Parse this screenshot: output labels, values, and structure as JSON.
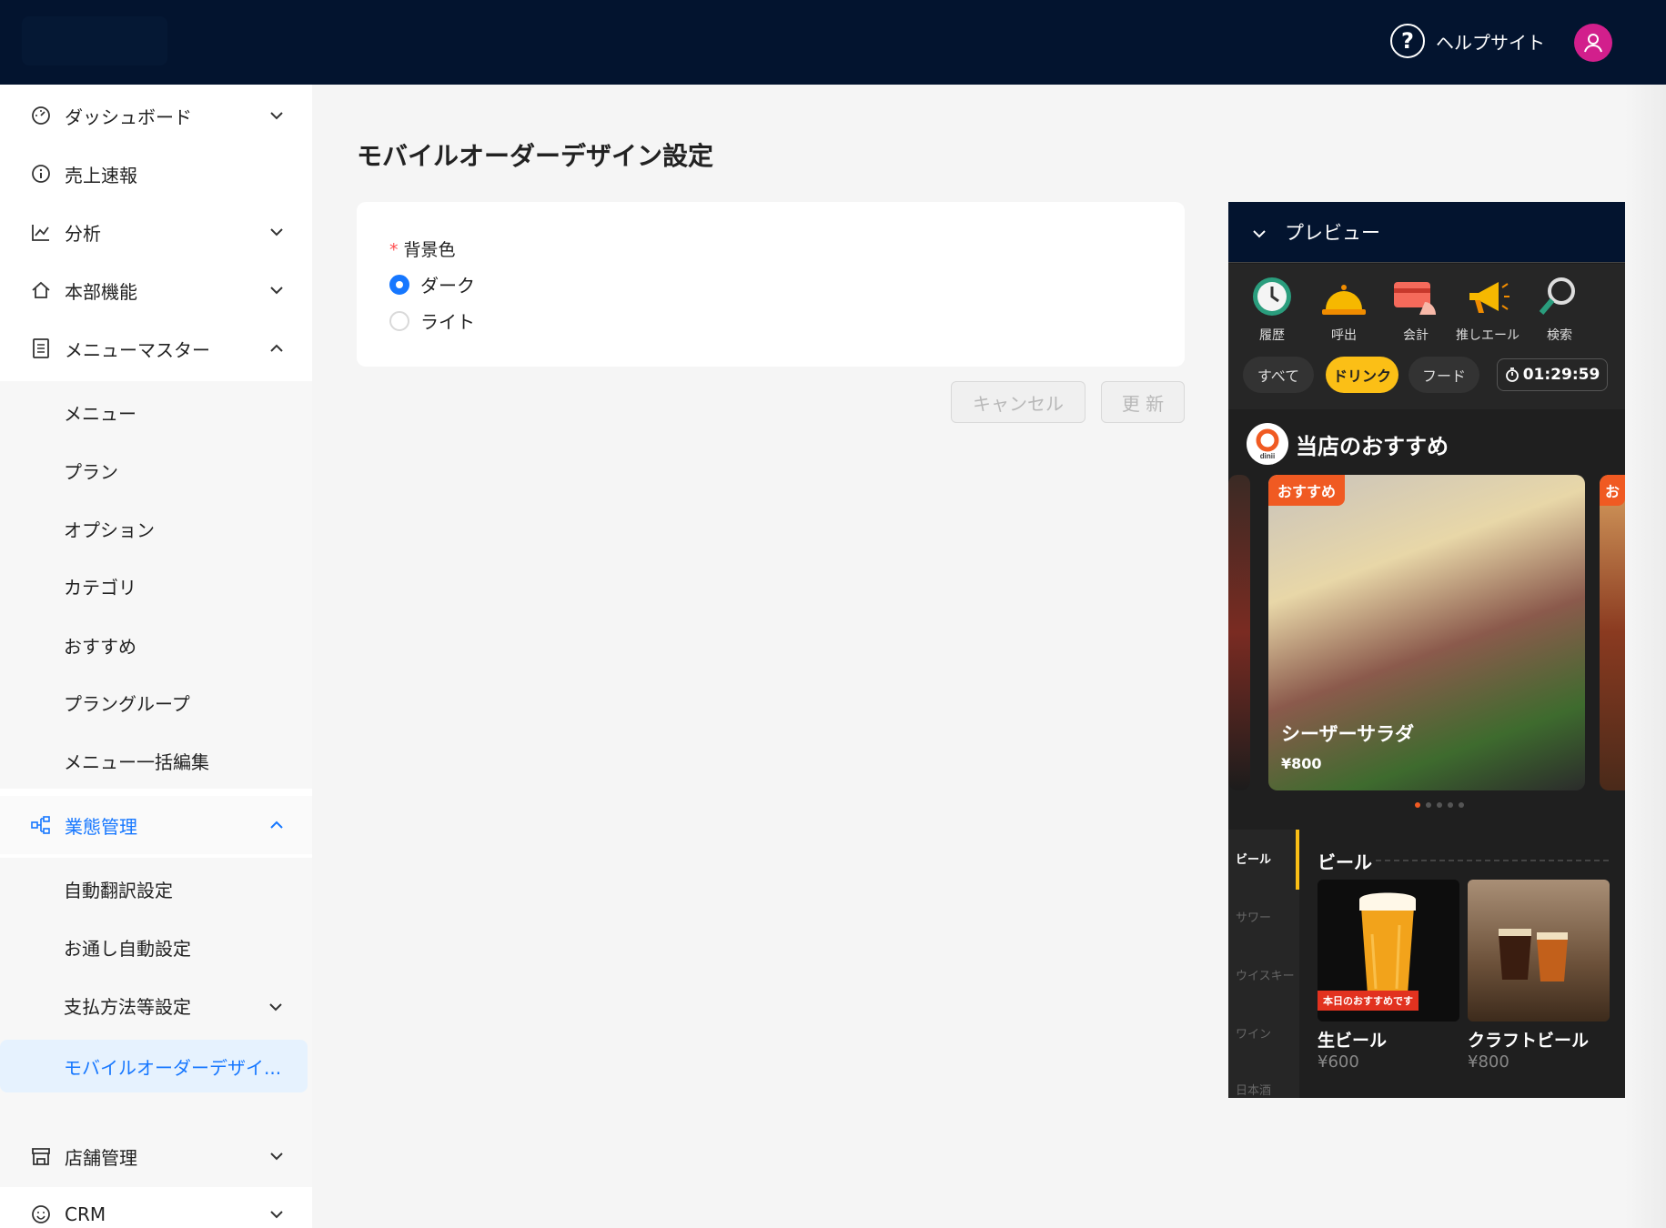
{
  "header": {
    "help_label": "ヘルプサイト",
    "help_glyph": "?"
  },
  "sidebar": {
    "items": [
      {
        "label": "ダッシュボード",
        "icon": "gauge-icon"
      },
      {
        "label": "売上速報",
        "icon": "info-icon"
      },
      {
        "label": "分析",
        "icon": "chart-icon"
      },
      {
        "label": "本部機能",
        "icon": "home-icon"
      },
      {
        "label": "メニューマスター",
        "icon": "list-icon"
      },
      {
        "label": "業態管理",
        "icon": "org-icon"
      },
      {
        "label": "店舗管理",
        "icon": "store-icon"
      },
      {
        "label": "CRM",
        "icon": "smile-icon"
      }
    ],
    "menu_master_sub": [
      "メニュー",
      "プラン",
      "オプション",
      "カテゴリ",
      "おすすめ",
      "プラングループ",
      "メニュー一括編集"
    ],
    "business_sub": [
      "自動翻訳設定",
      "お通し自動設定",
      "支払方法等設定",
      "モバイルオーダーデザイ..."
    ]
  },
  "main": {
    "title": "モバイルオーダーデザイン設定",
    "field_label": "背景色",
    "required_mark": "*",
    "options": [
      "ダーク",
      "ライト"
    ],
    "selected_option": "ダーク",
    "cancel_label": "キャンセル",
    "update_label": "更 新"
  },
  "preview": {
    "title": "プレビュー",
    "tools": [
      "履歴",
      "呼出",
      "会計",
      "推しエール",
      "検索"
    ],
    "chips": [
      "すべて",
      "ドリンク",
      "フード"
    ],
    "active_chip": "ドリンク",
    "timer": "01:29:59",
    "recommend_title": "当店のおすすめ",
    "logo_text": "dinii",
    "slide": {
      "badge": "おすすめ",
      "name": "シーザーサラダ",
      "price": "¥800"
    },
    "categories": [
      "ビール",
      "サワー",
      "ウイスキー",
      "ワイン",
      "日本酒"
    ],
    "section_title": "ビール",
    "products": [
      {
        "name": "生ビール",
        "price": "¥600",
        "badge": "本日のおすすめです"
      },
      {
        "name": "クラフトビール",
        "price": "¥800"
      }
    ]
  },
  "colors": {
    "topbar": "#03142f",
    "accent": "#1677ff",
    "avatar": "#d21f8c",
    "chip_active": "#fbbf16",
    "badge": "#f05a22"
  }
}
